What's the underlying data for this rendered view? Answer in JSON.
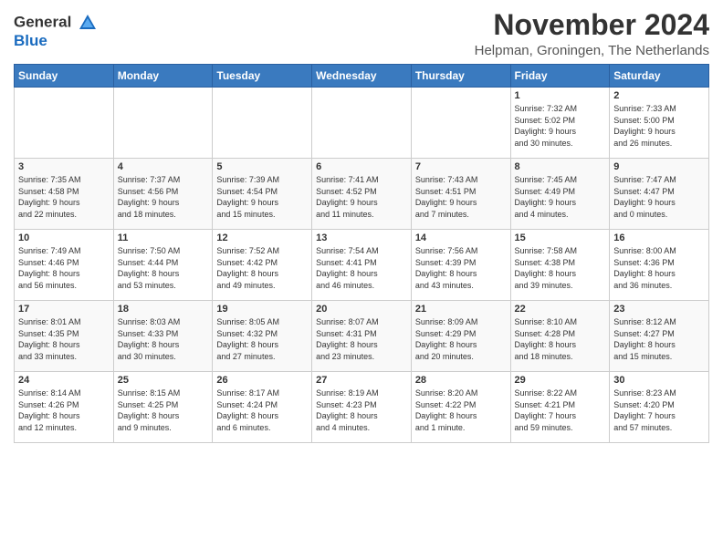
{
  "header": {
    "logo_line1": "General",
    "logo_line2": "Blue",
    "month_title": "November 2024",
    "location": "Helpman, Groningen, The Netherlands"
  },
  "days_of_week": [
    "Sunday",
    "Monday",
    "Tuesday",
    "Wednesday",
    "Thursday",
    "Friday",
    "Saturday"
  ],
  "weeks": [
    [
      {
        "day": "",
        "info": ""
      },
      {
        "day": "",
        "info": ""
      },
      {
        "day": "",
        "info": ""
      },
      {
        "day": "",
        "info": ""
      },
      {
        "day": "",
        "info": ""
      },
      {
        "day": "1",
        "info": "Sunrise: 7:32 AM\nSunset: 5:02 PM\nDaylight: 9 hours\nand 30 minutes."
      },
      {
        "day": "2",
        "info": "Sunrise: 7:33 AM\nSunset: 5:00 PM\nDaylight: 9 hours\nand 26 minutes."
      }
    ],
    [
      {
        "day": "3",
        "info": "Sunrise: 7:35 AM\nSunset: 4:58 PM\nDaylight: 9 hours\nand 22 minutes."
      },
      {
        "day": "4",
        "info": "Sunrise: 7:37 AM\nSunset: 4:56 PM\nDaylight: 9 hours\nand 18 minutes."
      },
      {
        "day": "5",
        "info": "Sunrise: 7:39 AM\nSunset: 4:54 PM\nDaylight: 9 hours\nand 15 minutes."
      },
      {
        "day": "6",
        "info": "Sunrise: 7:41 AM\nSunset: 4:52 PM\nDaylight: 9 hours\nand 11 minutes."
      },
      {
        "day": "7",
        "info": "Sunrise: 7:43 AM\nSunset: 4:51 PM\nDaylight: 9 hours\nand 7 minutes."
      },
      {
        "day": "8",
        "info": "Sunrise: 7:45 AM\nSunset: 4:49 PM\nDaylight: 9 hours\nand 4 minutes."
      },
      {
        "day": "9",
        "info": "Sunrise: 7:47 AM\nSunset: 4:47 PM\nDaylight: 9 hours\nand 0 minutes."
      }
    ],
    [
      {
        "day": "10",
        "info": "Sunrise: 7:49 AM\nSunset: 4:46 PM\nDaylight: 8 hours\nand 56 minutes."
      },
      {
        "day": "11",
        "info": "Sunrise: 7:50 AM\nSunset: 4:44 PM\nDaylight: 8 hours\nand 53 minutes."
      },
      {
        "day": "12",
        "info": "Sunrise: 7:52 AM\nSunset: 4:42 PM\nDaylight: 8 hours\nand 49 minutes."
      },
      {
        "day": "13",
        "info": "Sunrise: 7:54 AM\nSunset: 4:41 PM\nDaylight: 8 hours\nand 46 minutes."
      },
      {
        "day": "14",
        "info": "Sunrise: 7:56 AM\nSunset: 4:39 PM\nDaylight: 8 hours\nand 43 minutes."
      },
      {
        "day": "15",
        "info": "Sunrise: 7:58 AM\nSunset: 4:38 PM\nDaylight: 8 hours\nand 39 minutes."
      },
      {
        "day": "16",
        "info": "Sunrise: 8:00 AM\nSunset: 4:36 PM\nDaylight: 8 hours\nand 36 minutes."
      }
    ],
    [
      {
        "day": "17",
        "info": "Sunrise: 8:01 AM\nSunset: 4:35 PM\nDaylight: 8 hours\nand 33 minutes."
      },
      {
        "day": "18",
        "info": "Sunrise: 8:03 AM\nSunset: 4:33 PM\nDaylight: 8 hours\nand 30 minutes."
      },
      {
        "day": "19",
        "info": "Sunrise: 8:05 AM\nSunset: 4:32 PM\nDaylight: 8 hours\nand 27 minutes."
      },
      {
        "day": "20",
        "info": "Sunrise: 8:07 AM\nSunset: 4:31 PM\nDaylight: 8 hours\nand 23 minutes."
      },
      {
        "day": "21",
        "info": "Sunrise: 8:09 AM\nSunset: 4:29 PM\nDaylight: 8 hours\nand 20 minutes."
      },
      {
        "day": "22",
        "info": "Sunrise: 8:10 AM\nSunset: 4:28 PM\nDaylight: 8 hours\nand 18 minutes."
      },
      {
        "day": "23",
        "info": "Sunrise: 8:12 AM\nSunset: 4:27 PM\nDaylight: 8 hours\nand 15 minutes."
      }
    ],
    [
      {
        "day": "24",
        "info": "Sunrise: 8:14 AM\nSunset: 4:26 PM\nDaylight: 8 hours\nand 12 minutes."
      },
      {
        "day": "25",
        "info": "Sunrise: 8:15 AM\nSunset: 4:25 PM\nDaylight: 8 hours\nand 9 minutes."
      },
      {
        "day": "26",
        "info": "Sunrise: 8:17 AM\nSunset: 4:24 PM\nDaylight: 8 hours\nand 6 minutes."
      },
      {
        "day": "27",
        "info": "Sunrise: 8:19 AM\nSunset: 4:23 PM\nDaylight: 8 hours\nand 4 minutes."
      },
      {
        "day": "28",
        "info": "Sunrise: 8:20 AM\nSunset: 4:22 PM\nDaylight: 8 hours\nand 1 minute."
      },
      {
        "day": "29",
        "info": "Sunrise: 8:22 AM\nSunset: 4:21 PM\nDaylight: 7 hours\nand 59 minutes."
      },
      {
        "day": "30",
        "info": "Sunrise: 8:23 AM\nSunset: 4:20 PM\nDaylight: 7 hours\nand 57 minutes."
      }
    ]
  ]
}
